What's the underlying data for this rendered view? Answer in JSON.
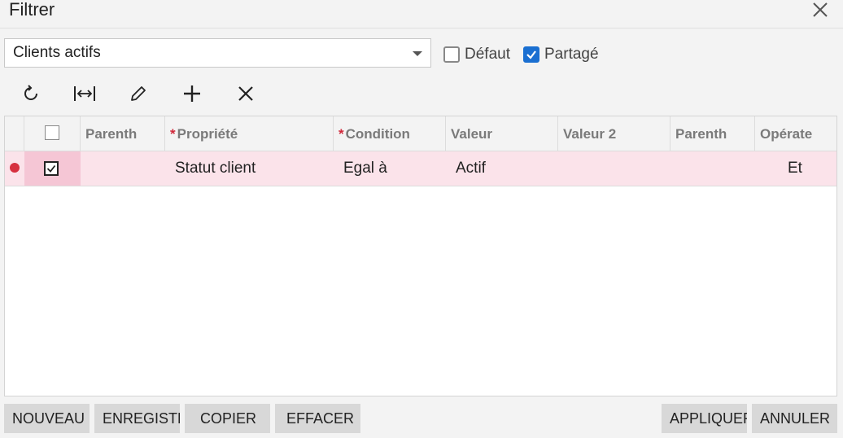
{
  "window": {
    "title": "Filtrer"
  },
  "filter_select": {
    "value": "Clients actifs"
  },
  "options": {
    "default_label": "Défaut",
    "default_checked": false,
    "shared_label": "Partagé",
    "shared_checked": true
  },
  "toolbar": {
    "icons": [
      "refresh-icon",
      "fit-columns-icon",
      "edit-icon",
      "add-icon",
      "delete-icon"
    ]
  },
  "grid": {
    "columns": [
      "Parenth",
      "Propriété",
      "Condition",
      "Valeur",
      "Valeur 2",
      "Parenth",
      "Opérate"
    ],
    "required_marker": "*",
    "rows": [
      {
        "active": true,
        "selected": true,
        "parenth_open": "",
        "property": "Statut client",
        "condition": "Egal à",
        "value": "Actif",
        "value2": "",
        "parenth_close": "",
        "operator": "Et"
      }
    ]
  },
  "buttons": {
    "new": "NOUVEAU",
    "save": "ENREGISTRER",
    "copy": "COPIER",
    "clear": "EFFACER",
    "apply": "APPLIQUER",
    "cancel": "ANNULER"
  },
  "colors": {
    "selected_row": "#fbe3ea",
    "selected_cell": "#f5c6d5",
    "required": "#d0283a",
    "checkbox_accent": "#1a6fd1",
    "button_bg": "#d8d8d8"
  }
}
